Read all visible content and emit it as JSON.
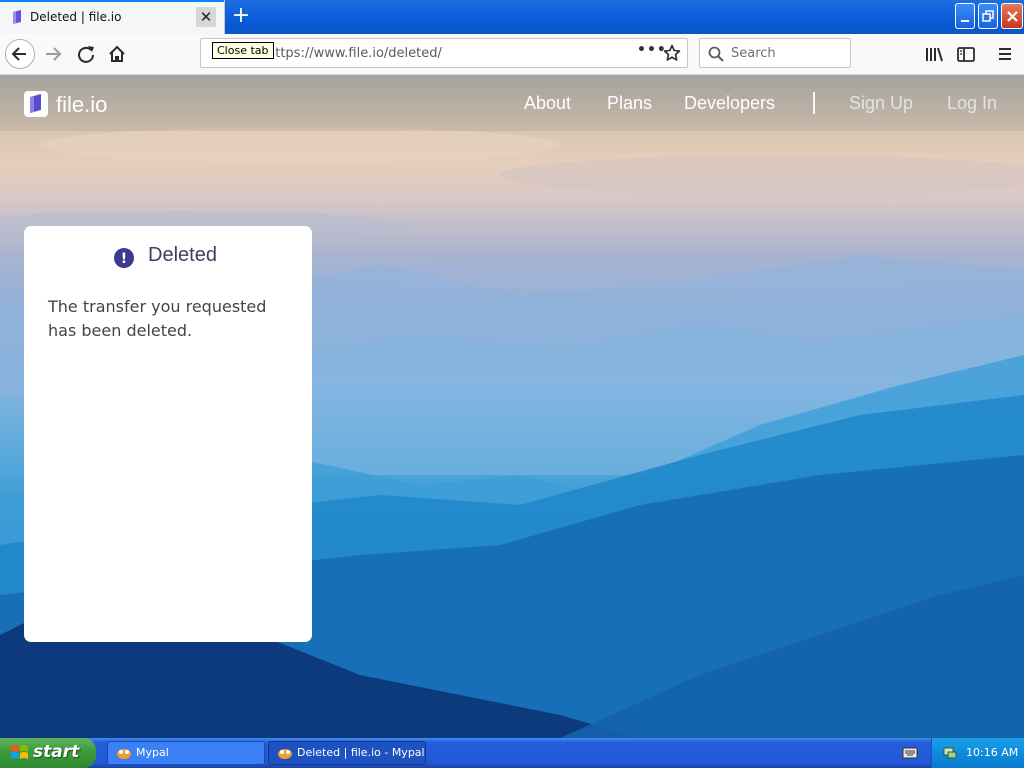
{
  "browser": {
    "tab_title": "Deleted | file.io",
    "tab_close_symbol": "✕",
    "new_tab_symbol": "+",
    "tooltip": "Close tab",
    "url": "https://www.file.io/deleted/",
    "page_actions_symbol": "•••",
    "search_placeholder": "Search"
  },
  "site": {
    "logo_text": "file.io",
    "nav": [
      "About",
      "Plans",
      "Developers",
      "Sign Up",
      "Log In"
    ]
  },
  "card": {
    "title": "Deleted",
    "icon_symbol": "!",
    "message": "The transfer you requested has been deleted."
  },
  "taskbar": {
    "start_label": "start",
    "tasks": [
      {
        "label": "Mypal",
        "active": false
      },
      {
        "label": "Deleted | file.io - Mypal",
        "active": true
      }
    ],
    "clock": "10:16 AM"
  },
  "colors": {
    "brand_purple": "#5b4bd1",
    "card_title": "#3f3e5f",
    "taskbar_blue": "#245edb",
    "start_green": "#3c9a3c"
  },
  "icons": [
    "back-arrow-icon",
    "forward-arrow-icon",
    "reload-icon",
    "home-icon",
    "bookmark-star-icon",
    "search-icon",
    "library-icon",
    "sidebar-icon",
    "hamburger-menu-icon",
    "alert-icon",
    "windows-logo-icon",
    "keyboard-icon",
    "network-icon"
  ]
}
